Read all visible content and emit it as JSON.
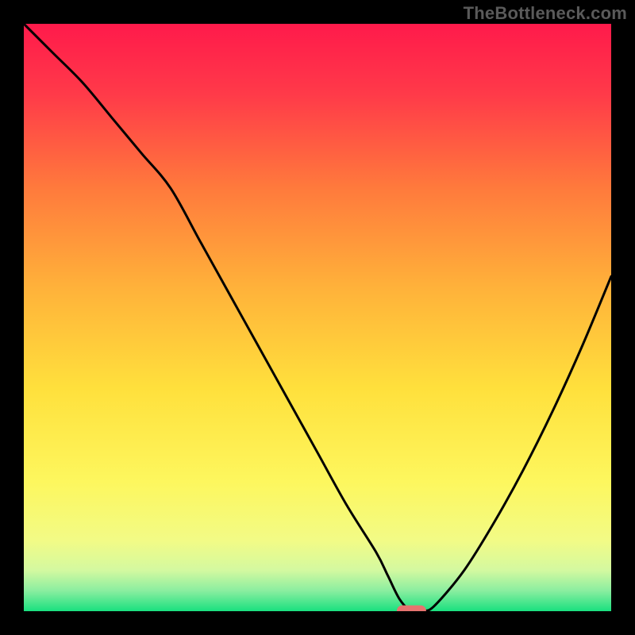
{
  "watermark": "TheBottleneck.com",
  "chart_data": {
    "type": "line",
    "title": "",
    "xlabel": "",
    "ylabel": "",
    "xlim": [
      0,
      100
    ],
    "ylim": [
      0,
      100
    ],
    "grid": false,
    "legend": false,
    "background_gradient": [
      {
        "stop": 0.0,
        "color": "#ff1a4b"
      },
      {
        "stop": 0.12,
        "color": "#ff3a49"
      },
      {
        "stop": 0.28,
        "color": "#ff7a3c"
      },
      {
        "stop": 0.45,
        "color": "#ffb23a"
      },
      {
        "stop": 0.62,
        "color": "#ffe03c"
      },
      {
        "stop": 0.78,
        "color": "#fdf75e"
      },
      {
        "stop": 0.88,
        "color": "#f2fb86"
      },
      {
        "stop": 0.93,
        "color": "#d4f9a0"
      },
      {
        "stop": 0.965,
        "color": "#8beea0"
      },
      {
        "stop": 1.0,
        "color": "#19e07f"
      }
    ],
    "curve": {
      "x": [
        0,
        5,
        10,
        15,
        20,
        25,
        30,
        35,
        40,
        45,
        50,
        55,
        60,
        62,
        64,
        66,
        68,
        70,
        75,
        80,
        85,
        90,
        95,
        100
      ],
      "y": [
        100,
        95,
        90,
        84,
        78,
        72,
        63,
        54,
        45,
        36,
        27,
        18,
        10,
        6,
        2,
        0,
        0,
        1,
        7,
        15,
        24,
        34,
        45,
        57
      ]
    },
    "marker": {
      "shape": "pill",
      "x": 66,
      "y": 0,
      "width_x_units": 5,
      "height_y_units": 2,
      "color": "#e6736f"
    }
  }
}
